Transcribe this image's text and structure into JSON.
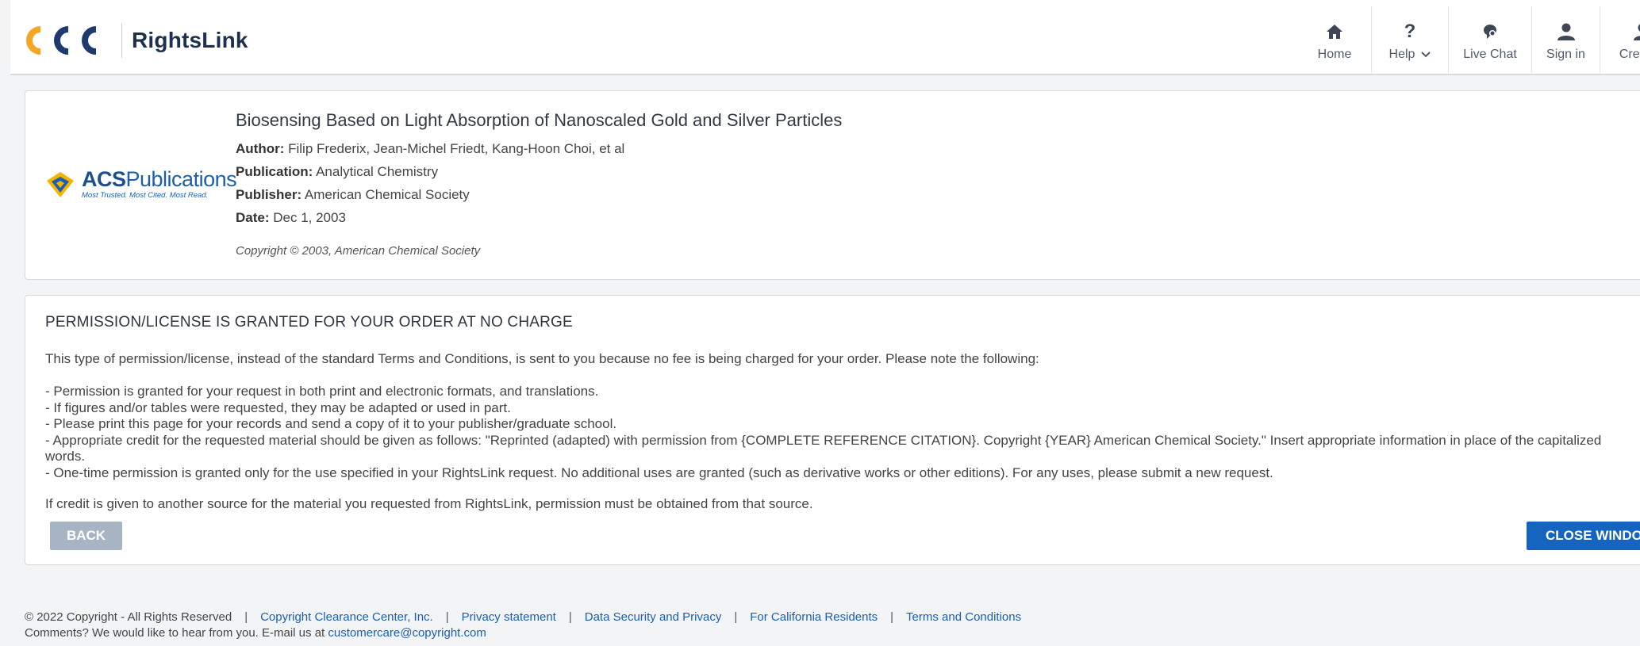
{
  "header": {
    "brand_name": "RightsLink",
    "logo_text": "CCC",
    "nav": {
      "home": "Home",
      "help": "Help",
      "live_chat": "Live Chat",
      "sign_in": "Sign in",
      "create_account": "Create A"
    }
  },
  "article": {
    "publisher_logo_text": "ACS Publications",
    "publisher_logo_bold": "ACS",
    "publisher_logo_rest": "Publications",
    "publisher_tagline": "Most Trusted. Most Cited. Most Read.",
    "title": "Biosensing Based on Light Absorption of Nanoscaled Gold and Silver Particles",
    "author_label": "Author:",
    "author": "Filip Frederix, Jean-Michel Friedt, Kang-Hoon Choi, et al",
    "publication_label": "Publication:",
    "publication": "Analytical Chemistry",
    "publisher_label": "Publisher:",
    "publisher": "American Chemical Society",
    "date_label": "Date:",
    "date": "Dec 1, 2003",
    "copyright": "Copyright © 2003, American Chemical Society"
  },
  "permission": {
    "heading": "PERMISSION/LICENSE IS GRANTED FOR YOUR ORDER AT NO CHARGE",
    "intro": "This type of permission/license, instead of the standard Terms and Conditions, is sent to you because no fee is being charged for your order. Please note the following:",
    "bullets": [
      "- Permission is granted for your request in both print and electronic formats, and translations.",
      "- If figures and/or tables were requested, they may be adapted or used in part.",
      "- Please print this page for your records and send a copy of it to your publisher/graduate school.",
      "- Appropriate credit for the requested material should be given as follows: \"Reprinted (adapted) with permission from {COMPLETE REFERENCE CITATION}. Copyright {YEAR} American Chemical Society.\" Insert appropriate information in place of the capitalized",
      "words.",
      "- One-time permission is granted only for the use specified in your RightsLink request. No additional uses are granted (such as derivative works or other editions). For any uses, please submit a new request."
    ],
    "credit_note": "If credit is given to another source for the material you requested from RightsLink, permission must be obtained from that source.",
    "back_label": "BACK",
    "close_label": "CLOSE WINDOW"
  },
  "footer": {
    "copyright": "© 2022 Copyright - All Rights Reserved",
    "links": [
      "Copyright Clearance Center, Inc.",
      "Privacy statement",
      "Data Security and Privacy",
      "For California Residents",
      "Terms and Conditions"
    ],
    "comments_text": "Comments? We would like to hear from you. E-mail us at",
    "email": "customercare@copyright.com"
  },
  "colors": {
    "primary_button": "#1565c0",
    "secondary_button": "#a7b4c4",
    "link": "#1a5fb4",
    "ccc_orange": "#f5a623",
    "ccc_navy": "#1f3a6e"
  }
}
